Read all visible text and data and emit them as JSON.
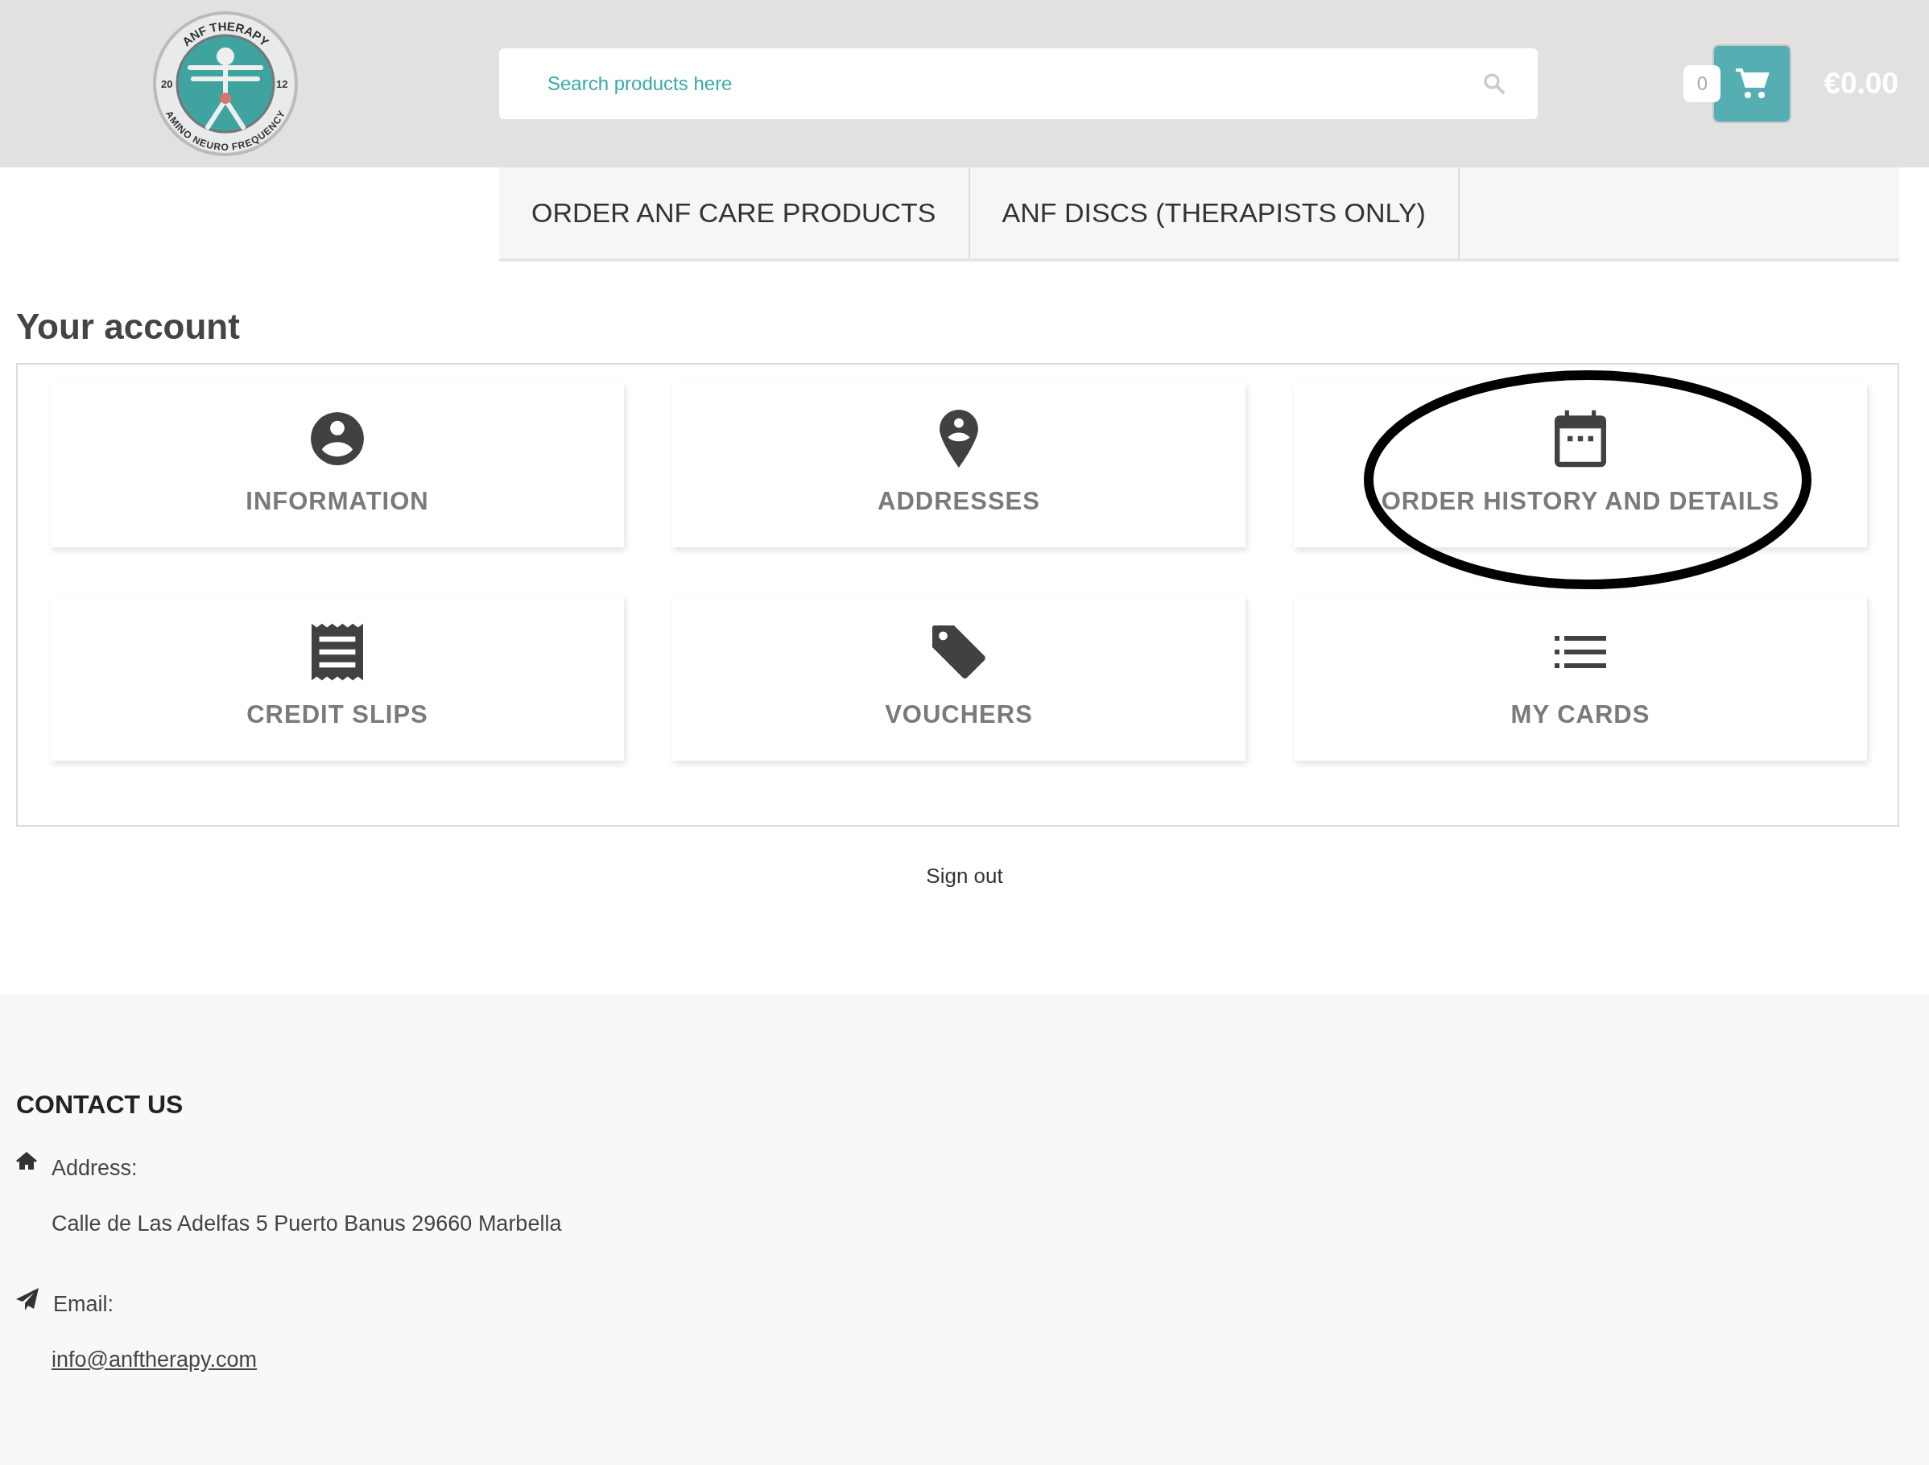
{
  "header": {
    "logo": {
      "top_text": "ANF THERAPY",
      "left_text": "20",
      "right_text": "12",
      "bottom_text": "AMINO NEURO FREQUENCY"
    },
    "search": {
      "placeholder": "Search products here"
    },
    "cart": {
      "count": "0",
      "total": "€0.00"
    }
  },
  "menu": [
    {
      "label": "ORDER ANF CARE PRODUCTS"
    },
    {
      "label": "ANF DISCS (THERAPISTS ONLY)"
    }
  ],
  "account": {
    "title": "Your account",
    "links": [
      {
        "label": "INFORMATION",
        "kind": "person"
      },
      {
        "label": "ADDRESSES",
        "kind": "pin"
      },
      {
        "label": "ORDER HISTORY AND DETAILS",
        "kind": "calendar",
        "circled": true
      },
      {
        "label": "CREDIT SLIPS",
        "kind": "receipt"
      },
      {
        "label": "VOUCHERS",
        "kind": "tag"
      },
      {
        "label": "MY CARDS",
        "kind": "list"
      }
    ],
    "sign_out": "Sign out"
  },
  "footer": {
    "title": "CONTACT US",
    "items": [
      {
        "kind": "address",
        "label": "Address:",
        "value": "Calle de Las Adelfas 5 Puerto Banus 29660 Marbella"
      },
      {
        "kind": "email",
        "label": "Email:",
        "value": "info@anftherapy.com"
      }
    ]
  }
}
